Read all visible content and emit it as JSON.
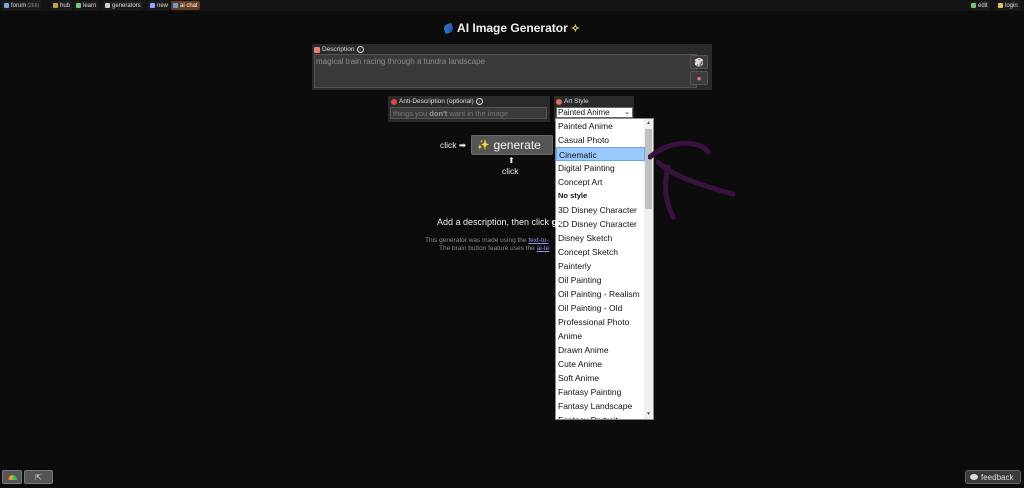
{
  "topbar": {
    "items": [
      {
        "label": "forum",
        "sub": "(266)",
        "color": "#7aa7e8"
      },
      {
        "label": "hub",
        "sub": "",
        "color": "#c99a52"
      },
      {
        "label": "learn",
        "sub": "",
        "color": "#7ac07a"
      },
      {
        "label": "generators",
        "sub": "",
        "color": "#cfcfcf"
      },
      {
        "label": "new",
        "sub": "",
        "color": "#9aa0ff"
      },
      {
        "label": "ai chat",
        "sub": "",
        "color": "#5aa0e8"
      }
    ],
    "right": [
      {
        "label": "edit",
        "color": "#7ac07a"
      },
      {
        "label": "login",
        "color": "#e0c060"
      }
    ]
  },
  "page": {
    "title": "AI Image Generator"
  },
  "description": {
    "label": "Description",
    "value": "magical train racing through a tundra landscape"
  },
  "anti_description": {
    "label": "Anti-Description (optional)",
    "placeholder_pre": "things you ",
    "placeholder_bold": "don't",
    "placeholder_post": " want in the image"
  },
  "art_style": {
    "label": "Art Style",
    "selected": "Painted Anime",
    "options": [
      "Painted Anime",
      "Casual Photo",
      "Cinematic",
      "Digital Painting",
      "Concept Art",
      "No style",
      "3D Disney Character",
      "2D Disney Character",
      "Disney Sketch",
      "Concept Sketch",
      "Painterly",
      "Oil Painting",
      "Oil Painting - Realism",
      "Oil Painting - Old",
      "Professional Photo",
      "Anime",
      "Drawn Anime",
      "Cute Anime",
      "Soft Anime",
      "Fantasy Painting",
      "Fantasy Landscape",
      "Fantasy Portrait"
    ],
    "highlighted": "Cinematic",
    "bold_option": "No style"
  },
  "generate": {
    "click_left": "click ➡",
    "button_label": "generate",
    "arrow": "⬆",
    "click_below": "click"
  },
  "hint": {
    "text": "Add a description, then click ",
    "bold": "ge"
  },
  "info": {
    "line1": "This generator was made using the ",
    "line1_link": "text-to-",
    "line2": "The brain button feature uses the ",
    "line2_link": "ai-te"
  },
  "bottom": {
    "feedback": "feedback",
    "expand_icon": "⇱"
  }
}
